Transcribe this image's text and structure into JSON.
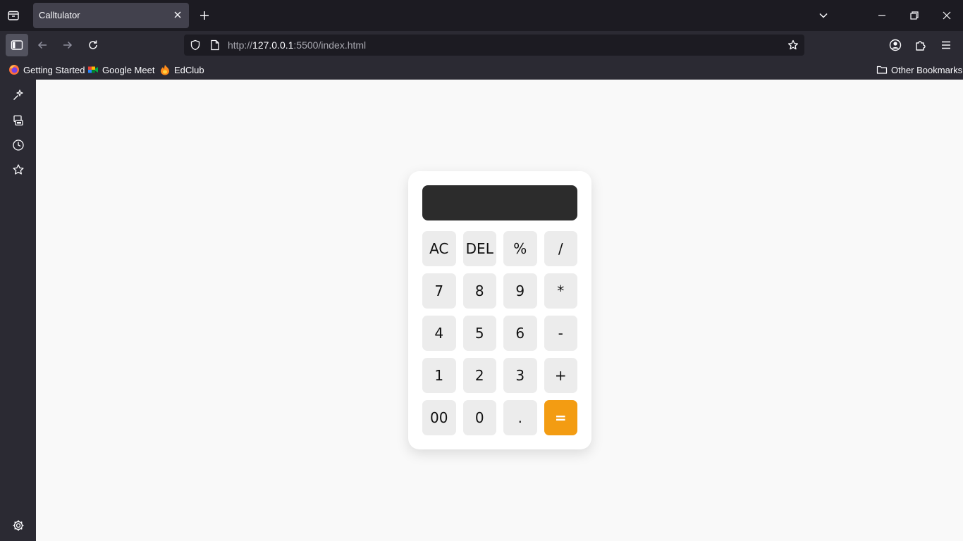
{
  "browser": {
    "tab": {
      "title": "Calltulator"
    },
    "url": {
      "scheme": "http://",
      "host": "127.0.0.1",
      "rest": ":5500/index.html"
    },
    "bookmarks": [
      {
        "label": "Getting Started",
        "icon": "firefox-icon"
      },
      {
        "label": "Google Meet",
        "icon": "google-meet-icon"
      },
      {
        "label": "EdClub",
        "icon": "edclub-icon"
      }
    ],
    "other_bookmarks": "Other Bookmarks",
    "sidebar_icons": [
      "ai-chatbot-icon",
      "synced-tabs-icon",
      "history-icon",
      "bookmarks-star-icon",
      "settings-gear-icon"
    ]
  },
  "calculator": {
    "display_value": "",
    "keys": [
      "AC",
      "DEL",
      "%",
      "/",
      "7",
      "8",
      "9",
      "*",
      "4",
      "5",
      "6",
      "-",
      "1",
      "2",
      "3",
      "+",
      "00",
      "0",
      ".",
      "="
    ],
    "accent_color": "#f39c12",
    "display_color": "#2c2c2c",
    "key_color": "#ececec"
  }
}
